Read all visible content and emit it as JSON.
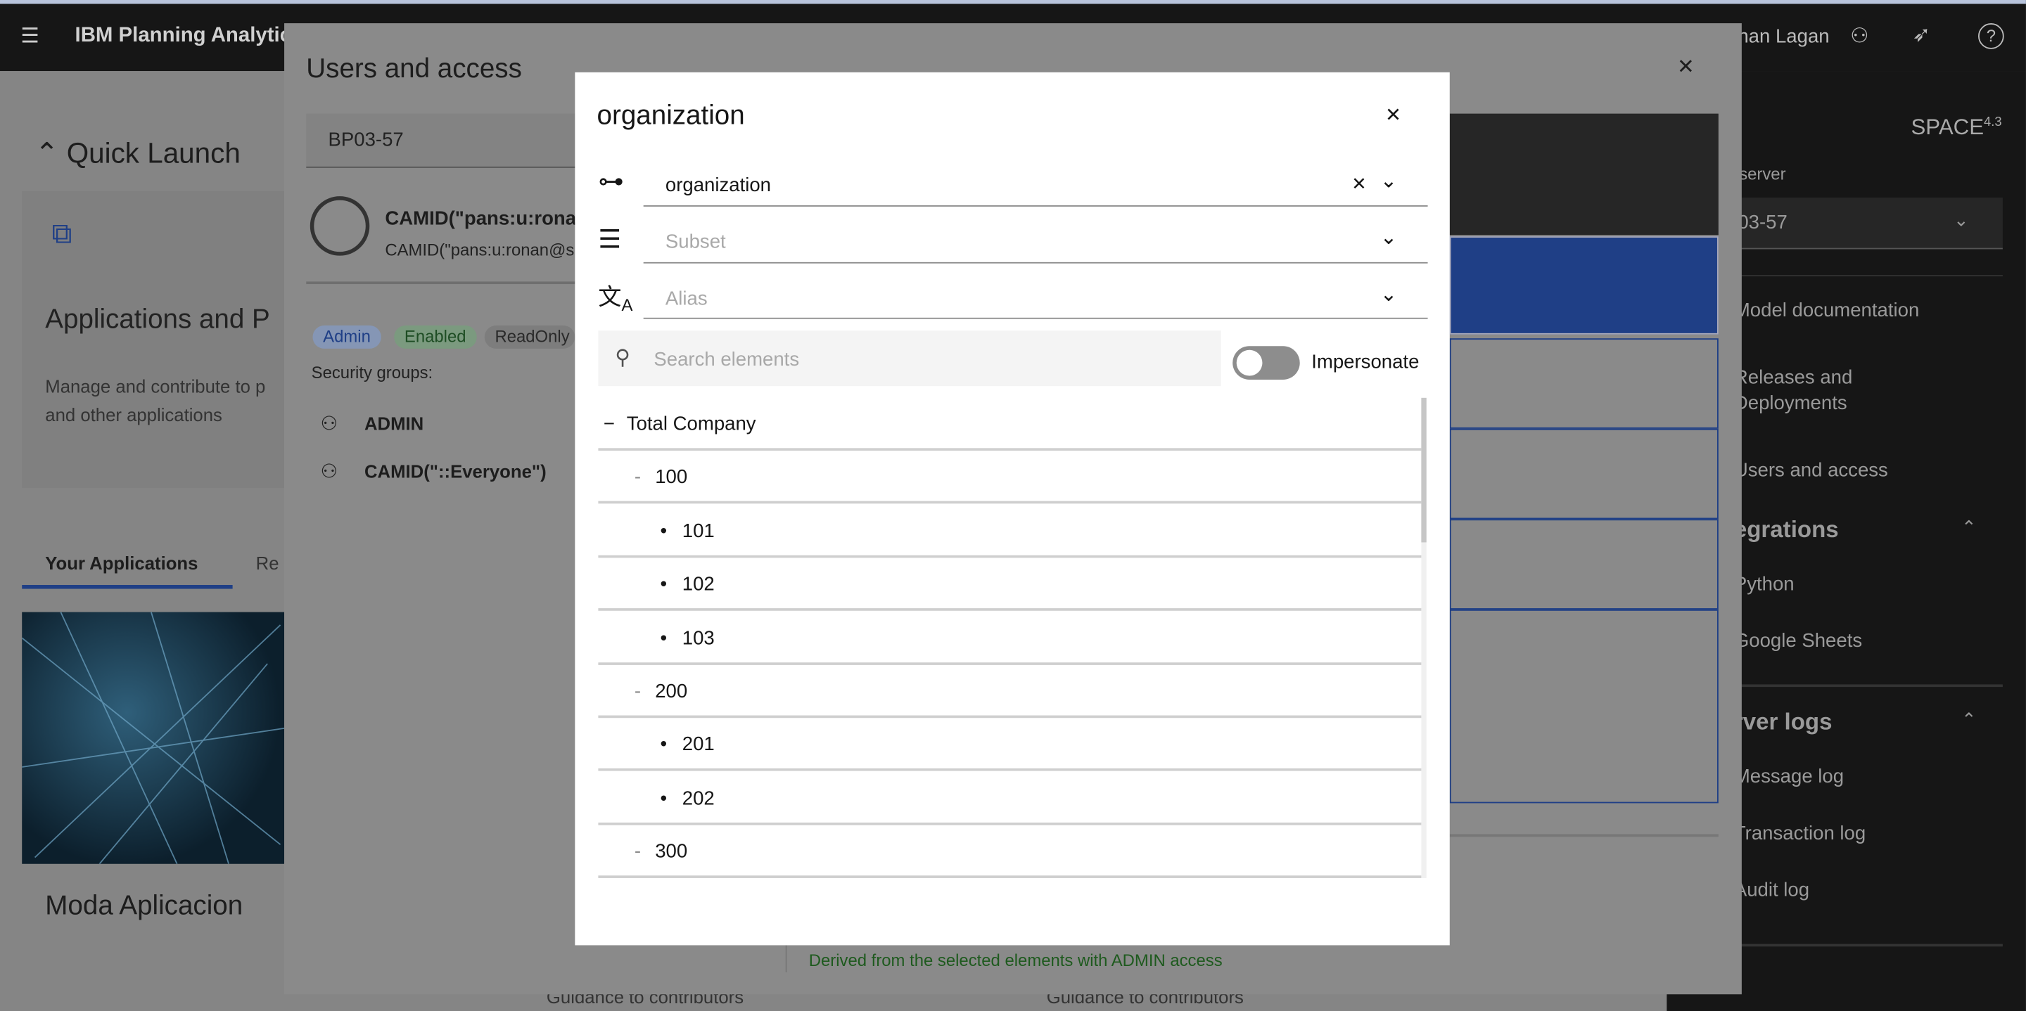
{
  "header": {
    "app_title": "IBM Planning Analytic",
    "user_name": "nan Lagan"
  },
  "quick_launch": {
    "title": "Quick Launch",
    "card_title": "Applications and P",
    "card_desc_1": "Manage and contribute to p",
    "card_desc_2": "and other applications",
    "tabs": [
      "Your Applications",
      "Re"
    ],
    "app_name": "Moda Aplicacion",
    "guidance": [
      "Guidance to contributors",
      "Guidance to contributors"
    ]
  },
  "users_access": {
    "title": "Users and access",
    "server_value": "BP03-57",
    "user_name": "CAMID(\"pans:u:rona",
    "user_id": "CAMID(\"pans:u:ronan@s",
    "tags": [
      "Admin",
      "Enabled",
      "ReadOnly"
    ],
    "security_label": "Security groups:",
    "groups": [
      "ADMIN",
      "CAMID(\"::Everyone\")"
    ],
    "derived_note": "Derived from the selected elements with ADMIN access"
  },
  "right_panel": {
    "brand": "SPACE",
    "version": "4.3",
    "server_label": "server",
    "server_value": "03-57",
    "items": [
      "Model documentation",
      "Releases and",
      "Deployments",
      "Users and access"
    ],
    "integrations": "egrations",
    "integration_items": [
      "Python",
      "Google Sheets"
    ],
    "server_logs": "rver logs",
    "log_items": [
      "Message log",
      "Transaction log",
      "Audit log"
    ]
  },
  "modal": {
    "title": "organization",
    "hierarchy_value": "organization",
    "subset_placeholder": "Subset",
    "alias_placeholder": "Alias",
    "search_placeholder": "Search elements",
    "impersonate_label": "Impersonate",
    "impersonate_on": false,
    "tree": [
      {
        "label": "Total Company",
        "level": 0,
        "marker": "−"
      },
      {
        "label": "100",
        "level": 1,
        "marker": "-"
      },
      {
        "label": "101",
        "level": 2,
        "marker": "•"
      },
      {
        "label": "102",
        "level": 2,
        "marker": "•"
      },
      {
        "label": "103",
        "level": 2,
        "marker": "•"
      },
      {
        "label": "200",
        "level": 1,
        "marker": "-"
      },
      {
        "label": "201",
        "level": 2,
        "marker": "•"
      },
      {
        "label": "202",
        "level": 2,
        "marker": "•"
      },
      {
        "label": "300",
        "level": 1,
        "marker": "-"
      }
    ]
  },
  "colors": {
    "accent": "#0f62fe",
    "selected_block": "#1f3f86",
    "toggle_off": "#8d8d8d",
    "note_green": "#1e5a1e"
  }
}
